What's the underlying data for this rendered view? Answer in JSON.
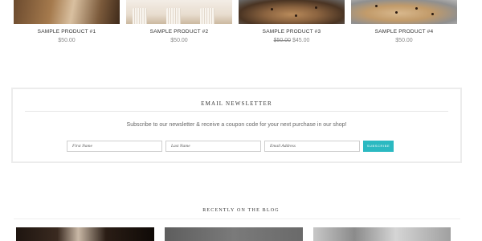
{
  "products": [
    {
      "name": "SAMPLE PRODUCT #1",
      "price": "$50.00",
      "old_price": ""
    },
    {
      "name": "SAMPLE PRODUCT #2",
      "price": "$50.00",
      "old_price": ""
    },
    {
      "name": "SAMPLE PRODUCT #3",
      "price": "$45.00",
      "old_price": "$50.00"
    },
    {
      "name": "SAMPLE PRODUCT #4",
      "price": "$50.00",
      "old_price": ""
    }
  ],
  "newsletter": {
    "title": "EMAIL NEWSLETTER",
    "text": "Subscribe to our newsletter & receive a coupon code for your next purchase in our shop!",
    "first_name_placeholder": "First Name",
    "last_name_placeholder": "Last Name",
    "email_placeholder": "Email Address",
    "subscribe_label": "SUBSCRIBE",
    "button_color": "#2bb9c1"
  },
  "blog": {
    "title": "RECENTLY ON THE BLOG"
  }
}
